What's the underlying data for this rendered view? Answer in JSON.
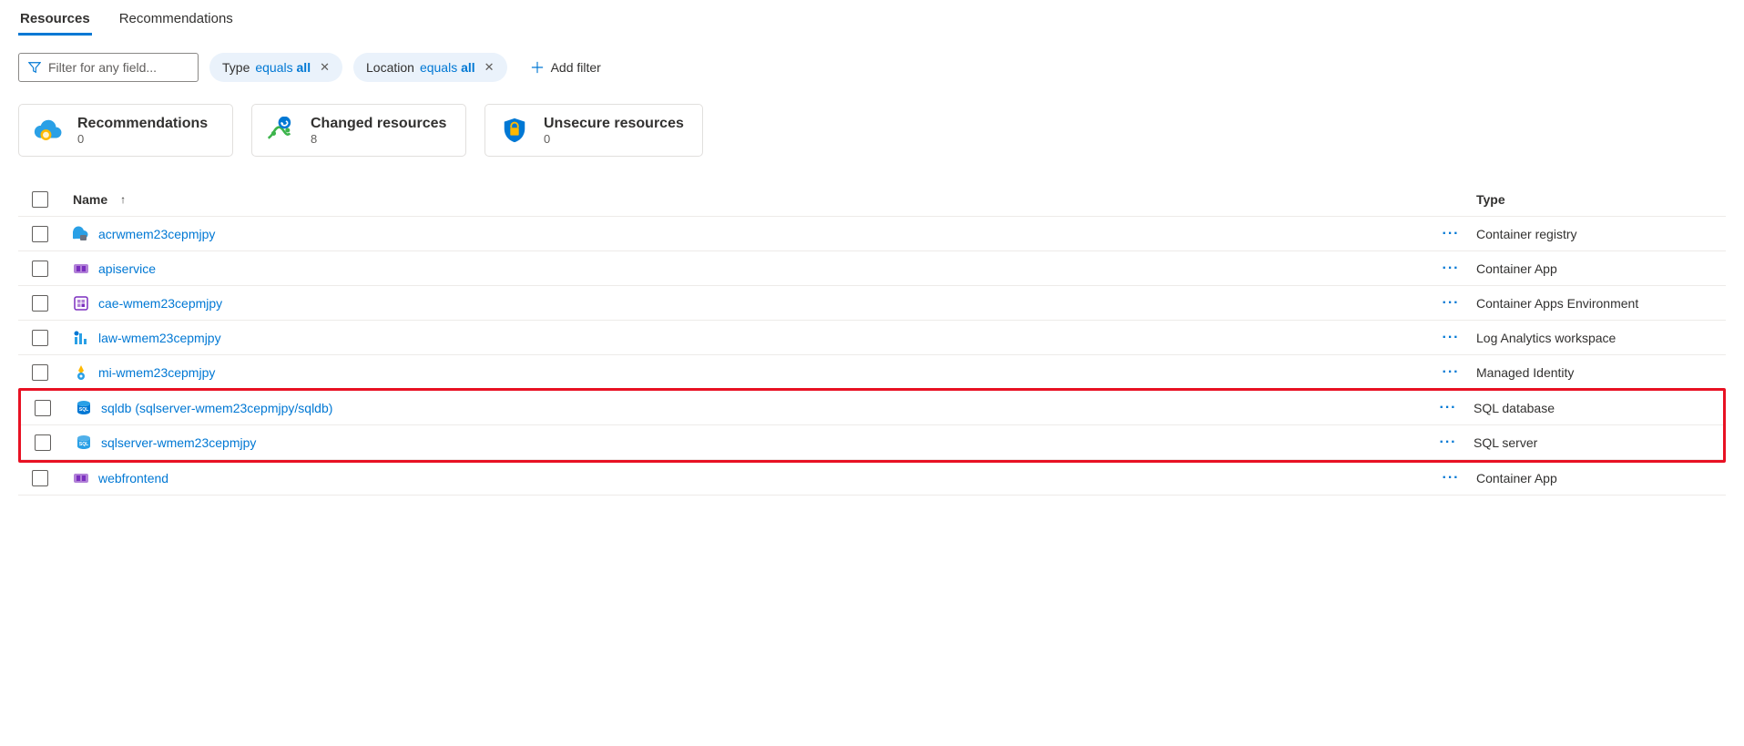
{
  "tabs": {
    "resources": "Resources",
    "recommendations": "Recommendations"
  },
  "filters": {
    "placeholder": "Filter for any field...",
    "type_label": "Type",
    "type_op": "equals",
    "type_val": "all",
    "location_label": "Location",
    "location_op": "equals",
    "location_val": "all",
    "add_filter": "Add filter"
  },
  "cards": {
    "recommendations": {
      "title": "Recommendations",
      "count": "0"
    },
    "changed": {
      "title": "Changed resources",
      "count": "8"
    },
    "unsecure": {
      "title": "Unsecure resources",
      "count": "0"
    }
  },
  "table": {
    "col_name": "Name",
    "col_type": "Type",
    "more": "···",
    "rows": [
      {
        "name": "acrwmem23cepmjpy",
        "type": "Container registry",
        "icon": "registry"
      },
      {
        "name": "apiservice",
        "type": "Container App",
        "icon": "containerapp"
      },
      {
        "name": "cae-wmem23cepmjpy",
        "type": "Container Apps Environment",
        "icon": "cae"
      },
      {
        "name": "law-wmem23cepmjpy",
        "type": "Log Analytics workspace",
        "icon": "law"
      },
      {
        "name": "mi-wmem23cepmjpy",
        "type": "Managed Identity",
        "icon": "identity"
      },
      {
        "name": "sqldb (sqlserver-wmem23cepmjpy/sqldb)",
        "type": "SQL database",
        "icon": "sqldb",
        "highlighted": true
      },
      {
        "name": "sqlserver-wmem23cepmjpy",
        "type": "SQL server",
        "icon": "sqlserver",
        "highlighted": true
      },
      {
        "name": "webfrontend",
        "type": "Container App",
        "icon": "containerapp"
      }
    ]
  }
}
